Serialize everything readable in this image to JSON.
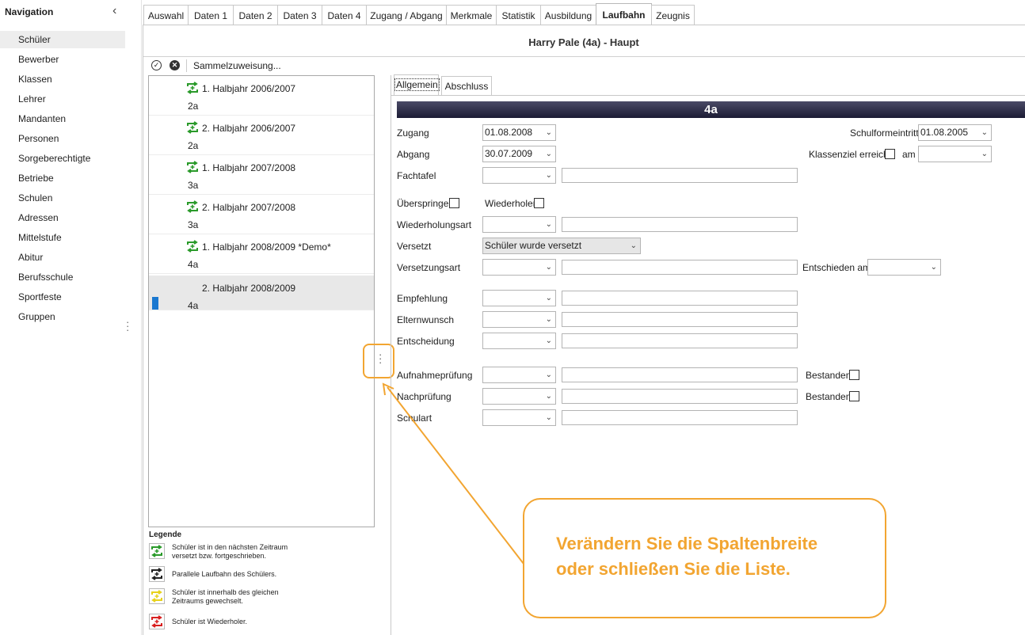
{
  "navigation": {
    "title": "Navigation",
    "items": [
      "Schüler",
      "Bewerber",
      "Klassen",
      "Lehrer",
      "Mandanten",
      "Personen",
      "Sorgeberechtigte",
      "Betriebe",
      "Schulen",
      "Adressen",
      "Mittelstufe",
      "Abitur",
      "Berufsschule",
      "Sportfeste",
      "Gruppen"
    ],
    "active": "Schüler"
  },
  "tabs": [
    "Auswahl",
    "Daten 1",
    "Daten 2",
    "Daten 3",
    "Daten 4",
    "Zugang / Abgang",
    "Merkmale",
    "Statistik",
    "Ausbildung",
    "Laufbahn",
    "Zeugnis"
  ],
  "active_tab": "Laufbahn",
  "page_title": "Harry Pale (4a) - Haupt",
  "toolbar": {
    "sammel_label": "Sammelzuweisung..."
  },
  "laufbahn": [
    {
      "period": "1. Halbjahr 2006/2007",
      "class": "2a",
      "icon": "versetzt-icon"
    },
    {
      "period": "2. Halbjahr 2006/2007",
      "class": "2a",
      "icon": "versetzt-icon"
    },
    {
      "period": "1. Halbjahr 2007/2008",
      "class": "3a",
      "icon": "versetzt-icon"
    },
    {
      "period": "2. Halbjahr 2007/2008",
      "class": "3a",
      "icon": "versetzt-icon"
    },
    {
      "period": "1. Halbjahr 2008/2009 *Demo*",
      "class": "4a",
      "icon": "versetzt-icon"
    },
    {
      "period": "2. Halbjahr 2008/2009",
      "class": "4a",
      "icon": "",
      "selected": true
    }
  ],
  "legend": {
    "title": "Legende",
    "items": [
      {
        "text": "Schüler ist in den nächsten Zeitraum versetzt bzw. fortgeschrieben.",
        "color": "#2a9a2a"
      },
      {
        "text": "Parallele Laufbahn des Schülers.",
        "color": "#222222"
      },
      {
        "text": "Schüler ist innerhalb des gleichen Zeitraums gewechselt.",
        "color": "#e8d21a"
      },
      {
        "text": "Schüler ist Wiederholer.",
        "color": "#d82020"
      }
    ]
  },
  "subtabs": [
    "Allgemein",
    "Abschluss"
  ],
  "active_subtab": "Allgemein",
  "class_banner": "4a",
  "form": {
    "zugang": {
      "label": "Zugang",
      "value": "01.08.2008"
    },
    "abgang": {
      "label": "Abgang",
      "value": "30.07.2009"
    },
    "fachtafel": {
      "label": "Fachtafel",
      "value": ""
    },
    "schulformeintritt": {
      "label": "Schulformeintritt",
      "value": "01.08.2005"
    },
    "klassenziel": {
      "label": "Klassenziel erreicht",
      "checked": false
    },
    "am": {
      "label": "am",
      "value": ""
    },
    "ueberspringer": {
      "label": "Überspringer",
      "checked": false
    },
    "wiederholer": {
      "label": "Wiederholer",
      "checked": false
    },
    "wiederholungsart": {
      "label": "Wiederholungsart",
      "value": ""
    },
    "versetzt": {
      "label": "Versetzt",
      "value": "Schüler wurde versetzt"
    },
    "versetzungsart": {
      "label": "Versetzungsart",
      "value": ""
    },
    "entschieden_am": {
      "label": "Entschieden am",
      "value": ""
    },
    "empfehlung": {
      "label": "Empfehlung",
      "value": ""
    },
    "elternwunsch": {
      "label": "Elternwunsch",
      "value": ""
    },
    "entscheidung": {
      "label": "Entscheidung",
      "value": ""
    },
    "aufnahmepruefung": {
      "label": "Aufnahmeprüfung",
      "value": "",
      "bestanden_label": "Bestanden",
      "bestanden": false
    },
    "nachpruefung": {
      "label": "Nachprüfung",
      "value": "",
      "bestanden_label": "Bestanden",
      "bestanden": false
    },
    "schulart": {
      "label": "Schulart",
      "value": ""
    }
  },
  "callout": {
    "line1": "Verändern Sie die Spaltenbreite",
    "line2": "oder schließen Sie die Liste.",
    "color": "#f2a531"
  }
}
